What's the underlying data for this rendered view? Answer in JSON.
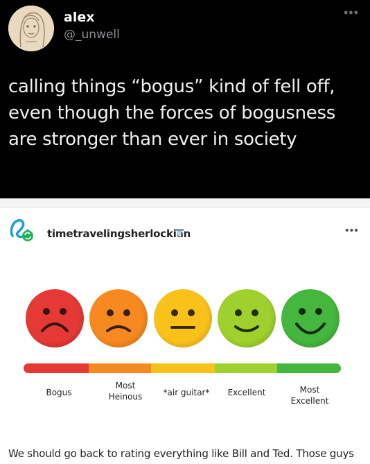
{
  "tweet": {
    "name": "alex",
    "handle": "@_unwell",
    "more_icon": "ellipsis-icon",
    "lines": [
      "calling things “bogus” kind of fell off,",
      "even though the forces of bogusness",
      "are stronger than ever  in society"
    ]
  },
  "post": {
    "username": "timetravelingsherlockian",
    "badge_icon": "badge-icon",
    "more_icon": "ellipsis-icon",
    "rating_scale": [
      {
        "label": "Bogus",
        "color": "#e53935"
      },
      {
        "label": "Most\nHeinous",
        "color": "#f6891f"
      },
      {
        "label": "*air guitar*",
        "color": "#f9c21b"
      },
      {
        "label": "Excellent",
        "color": "#9ed12d"
      },
      {
        "label": "Most\nExcellent",
        "color": "#45b63e"
      }
    ],
    "caption": "We should go back to rating everything like Bill and Ted. Those guys"
  },
  "colors": {
    "tweet_bg": "#000000",
    "tumblr_green": "#21b35b",
    "tumblr_blue": "#1b9ed6"
  }
}
